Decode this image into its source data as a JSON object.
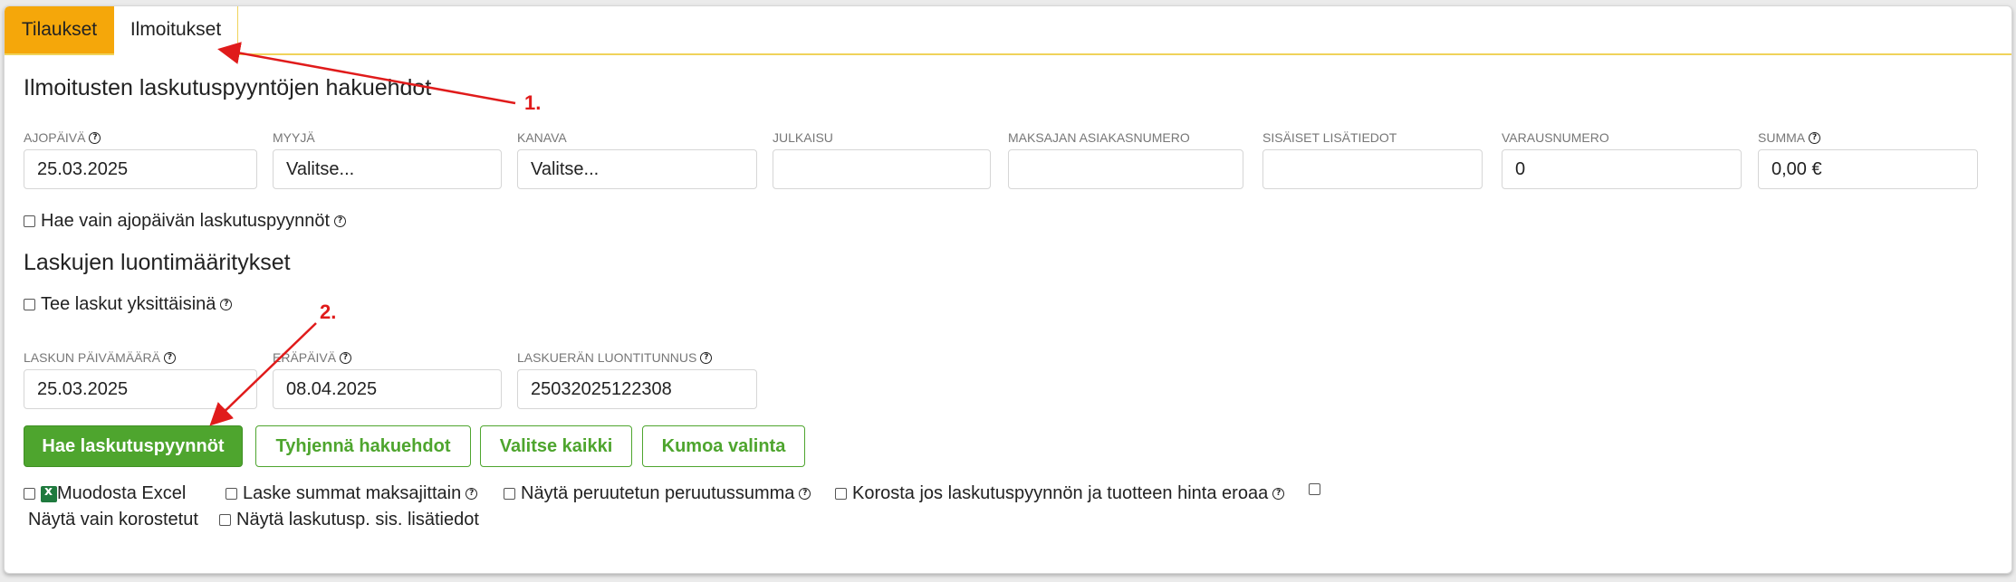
{
  "tabs": [
    {
      "label": "Tilaukset",
      "active": true
    },
    {
      "label": "Ilmoitukset",
      "active": false
    }
  ],
  "search": {
    "heading": "Ilmoitusten laskutuspyyntöjen hakuehdot",
    "fields": {
      "ajopaiva": {
        "label": "AJOPÄIVÄ",
        "value": "25.03.2025"
      },
      "myyja": {
        "label": "MYYJÄ",
        "value": "Valitse..."
      },
      "kanava": {
        "label": "KANAVA",
        "value": "Valitse..."
      },
      "julkaisu": {
        "label": "JULKAISU",
        "value": ""
      },
      "maksaja": {
        "label": "MAKSAJAN ASIAKASNUMERO",
        "value": ""
      },
      "sisaiset": {
        "label": "SISÄISET LISÄTIEDOT",
        "value": ""
      },
      "varausnumero": {
        "label": "VARAUSNUMERO",
        "value": "0"
      },
      "summa": {
        "label": "SUMMA",
        "value": "0,00 €"
      }
    },
    "only_runday_label": "Hae vain ajopäivän laskutuspyynnöt"
  },
  "invoice": {
    "heading": "Laskujen luontimääritykset",
    "individual_label": "Tee laskut yksittäisinä",
    "fields": {
      "laskun_pvm": {
        "label": "LASKUN PÄIVÄMÄÄRÄ",
        "value": "25.03.2025"
      },
      "erapaiva": {
        "label": "ERÄPÄIVÄ",
        "value": "08.04.2025"
      },
      "luontitunnus": {
        "label": "LASKUERÄN LUONTITUNNUS",
        "value": "25032025122308"
      }
    }
  },
  "buttons": {
    "search": "Hae laskutuspyynnöt",
    "clear": "Tyhjennä hakuehdot",
    "select_all": "Valitse kaikki",
    "undo": "Kumoa valinta"
  },
  "options": {
    "excel": "Muodosta Excel",
    "sum_by_payer": "Laske summat maksajittain",
    "show_refund": "Näytä peruutetun peruutussumma",
    "highlight": "Korosta jos laskutuspyynnön ja tuotteen hinta eroaa",
    "only_highlighted": "Näytä vain korostetut",
    "show_internal": "Näytä laskutusp. sis. lisätiedot"
  },
  "annotations": [
    "1.",
    "2."
  ],
  "colors": {
    "active_tab": "#f5a70a",
    "accent_green": "#4ea52e",
    "annotation_red": "#e01b1b"
  }
}
